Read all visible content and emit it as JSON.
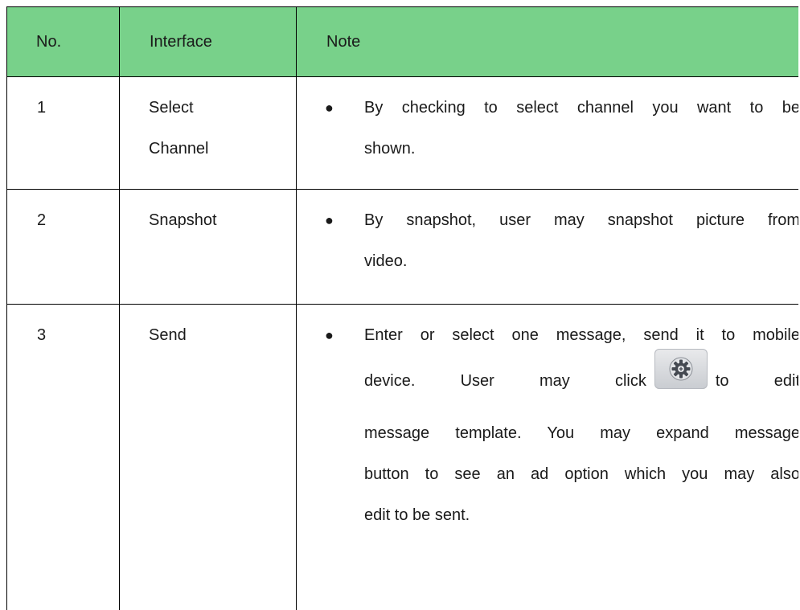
{
  "table": {
    "headers": {
      "no": "No.",
      "interface": "Interface",
      "note": "Note"
    },
    "rows": [
      {
        "no": "1",
        "interface_lines": [
          "Select",
          "Channel"
        ],
        "note_lines": [
          "By checking to select channel you want to be",
          "shown."
        ]
      },
      {
        "no": "2",
        "interface_lines": [
          "Snapshot"
        ],
        "note_lines": [
          "By snapshot, user may snapshot picture from",
          "video."
        ]
      },
      {
        "no": "3",
        "interface_lines": [
          "Send"
        ],
        "note_lines": {
          "line1": "Enter or select one message, send it to mobile",
          "line2_before": "device. User may click",
          "line2_after": "to edit",
          "line3": "message template. You may expand message",
          "line4": "button to see an ad option which you may also",
          "line5": "edit to be sent."
        },
        "inline_icon": "settings-gear-icon"
      }
    ]
  },
  "colors": {
    "header_background": "#78d18a",
    "border": "#000000"
  }
}
